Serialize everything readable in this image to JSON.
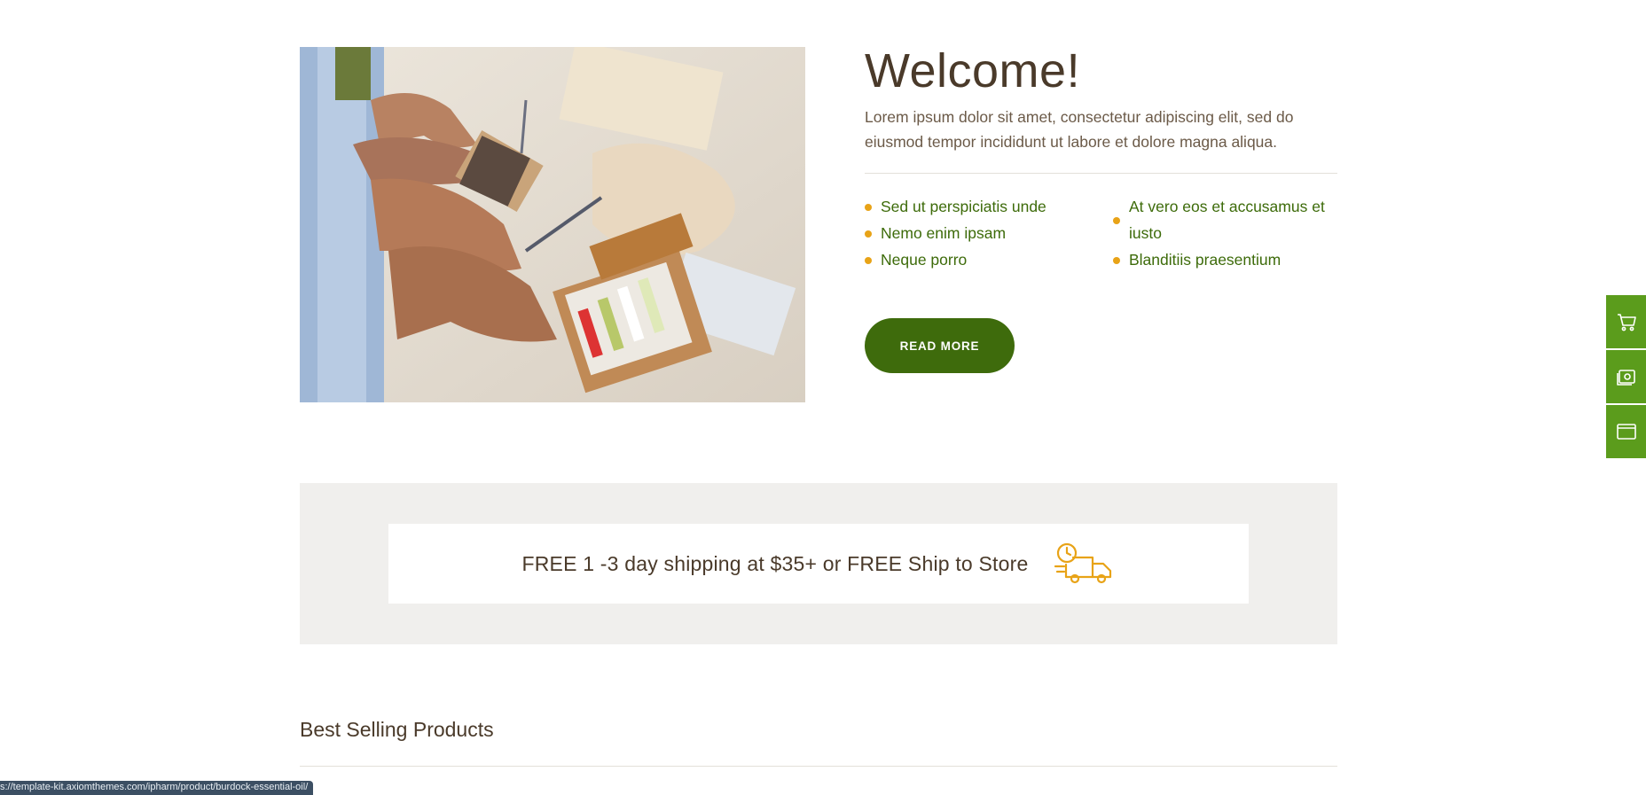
{
  "welcome": {
    "title": "Welcome!",
    "description": "Lorem ipsum dolor sit amet, consectetur adipiscing elit, sed do eiusmod tempor incididunt ut labore et dolore magna aliqua.",
    "features_left": [
      "Sed ut perspiciatis unde",
      "Nemo enim ipsam",
      "Neque porro"
    ],
    "features_right": [
      "At vero eos et accusamus et iusto",
      "Blanditiis praesentium"
    ],
    "read_more_label": "READ MORE"
  },
  "shipping": {
    "text": "FREE 1 -3 day shipping at $35+ or FREE Ship to Store",
    "icon": "delivery-truck-icon"
  },
  "best_selling": {
    "title": "Best Selling Products"
  },
  "status_bar": {
    "url": "s://template-kit.axiomthemes.com/ipharm/product/burdock-essential-oil/"
  },
  "side_widget": {
    "icons": [
      "cart-icon",
      "gallery-icon",
      "window-icon"
    ]
  },
  "colors": {
    "accent_green": "#3e6b0c",
    "side_green": "#5b9c1c",
    "bullet_orange": "#e8a317",
    "text_brown": "#4a3a2a",
    "band_grey": "#f0efed"
  }
}
